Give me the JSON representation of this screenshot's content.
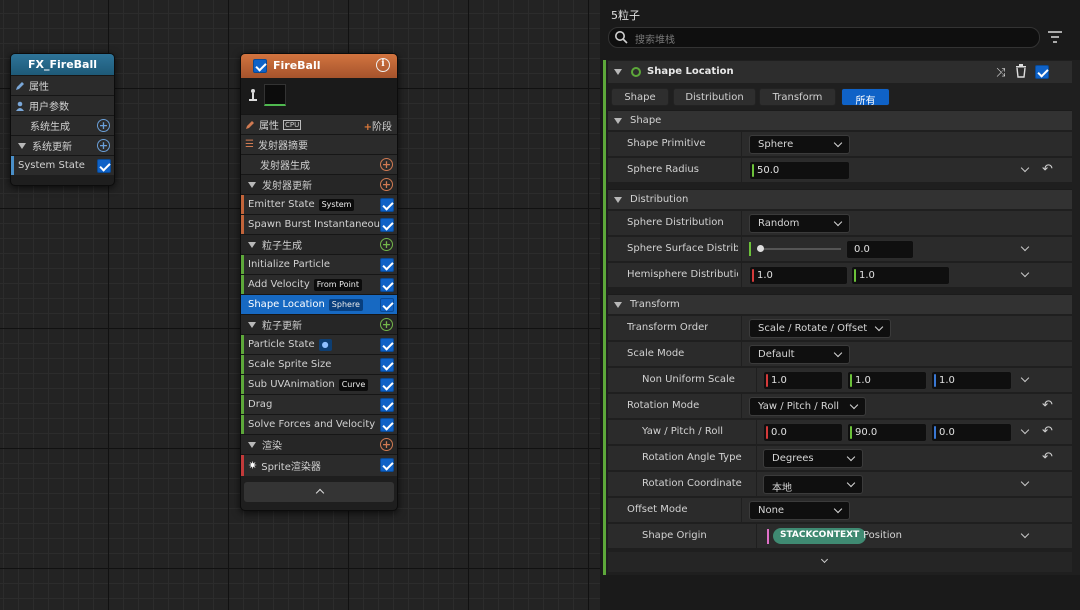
{
  "graph": {
    "system_node": {
      "title": "FX_FireBall",
      "rows": [
        {
          "label": "属性",
          "icon": "pencil-icon"
        },
        {
          "label": "用户参数",
          "icon": "user-icon"
        },
        {
          "label": "系统生成"
        },
        {
          "label": "系统更新"
        },
        {
          "label": "System State"
        }
      ]
    },
    "emitter_node": {
      "title": "FireBall",
      "properties_label": "属性",
      "cpu_label": "CPU",
      "stage_label": "阶段",
      "summary_label": "发射器摘要",
      "emitter_spawn": "发射器生成",
      "emitter_update": "发射器更新",
      "emitter_state": "Emitter State",
      "emitter_state_tag": "System",
      "spawn_burst": "Spawn Burst Instantaneous",
      "particle_spawn": "粒子生成",
      "init_particle": "Initialize Particle",
      "add_velocity": "Add Velocity",
      "add_velocity_tag": "From Point",
      "shape_location": "Shape Location",
      "shape_location_tag": "Sphere",
      "particle_update": "粒子更新",
      "particle_state": "Particle State",
      "particle_state_tag": "●",
      "scale_sprite": "Scale Sprite Size",
      "sub_uv": "Sub UVAnimation",
      "sub_uv_tag": "Curve",
      "drag": "Drag",
      "solve_forces": "Solve Forces and Velocity",
      "render": "渲染",
      "sprite_renderer": "Sprite渲染器",
      "collapse_glyph": "⌃"
    }
  },
  "panel": {
    "header": "5粒子",
    "search_placeholder": "搜索堆栈",
    "module_title": "Shape Location",
    "tabs": [
      "Shape",
      "Distribution",
      "Transform",
      "所有"
    ],
    "active_tab": "所有",
    "sections": {
      "shape": "Shape",
      "distribution": "Distribution",
      "transform": "Transform"
    },
    "shape_primitive": {
      "label": "Shape Primitive",
      "value": "Sphere"
    },
    "sphere_radius": {
      "label": "Sphere Radius",
      "value": "50.0"
    },
    "sphere_distribution": {
      "label": "Sphere Distribution",
      "value": "Random"
    },
    "sphere_surface": {
      "label": "Sphere Surface Distribu",
      "value": "0.0",
      "slider_fraction": 0.0
    },
    "hemisphere": {
      "label": "Hemisphere Distributior",
      "x": "1.0",
      "y": "1.0"
    },
    "transform_order": {
      "label": "Transform Order",
      "value": "Scale / Rotate / Offset"
    },
    "scale_mode": {
      "label": "Scale Mode",
      "value": "Default"
    },
    "non_uniform_scale": {
      "label": "Non Uniform Scale",
      "x": "1.0",
      "y": "1.0",
      "z": "1.0"
    },
    "rotation_mode": {
      "label": "Rotation Mode",
      "value": "Yaw / Pitch / Roll"
    },
    "ypr": {
      "label": "Yaw / Pitch / Roll",
      "x": "0.0",
      "y": "90.0",
      "z": "0.0"
    },
    "rotation_angle_type": {
      "label": "Rotation Angle Type",
      "value": "Degrees"
    },
    "rotation_coordinate": {
      "label": "Rotation Coordinate",
      "value": "本地"
    },
    "offset_mode": {
      "label": "Offset Mode",
      "value": "None"
    },
    "shape_origin": {
      "label": "Shape Origin",
      "context": "STACKCONTEXT",
      "value": "Position"
    }
  },
  "colors": {
    "accent_blue": "#0f62c7",
    "emitter_orange": "#c2643a",
    "system_teal": "#1e5a78",
    "axis_x": "#d43a3a",
    "axis_y": "#6cc23a",
    "axis_z": "#3a78d4"
  }
}
